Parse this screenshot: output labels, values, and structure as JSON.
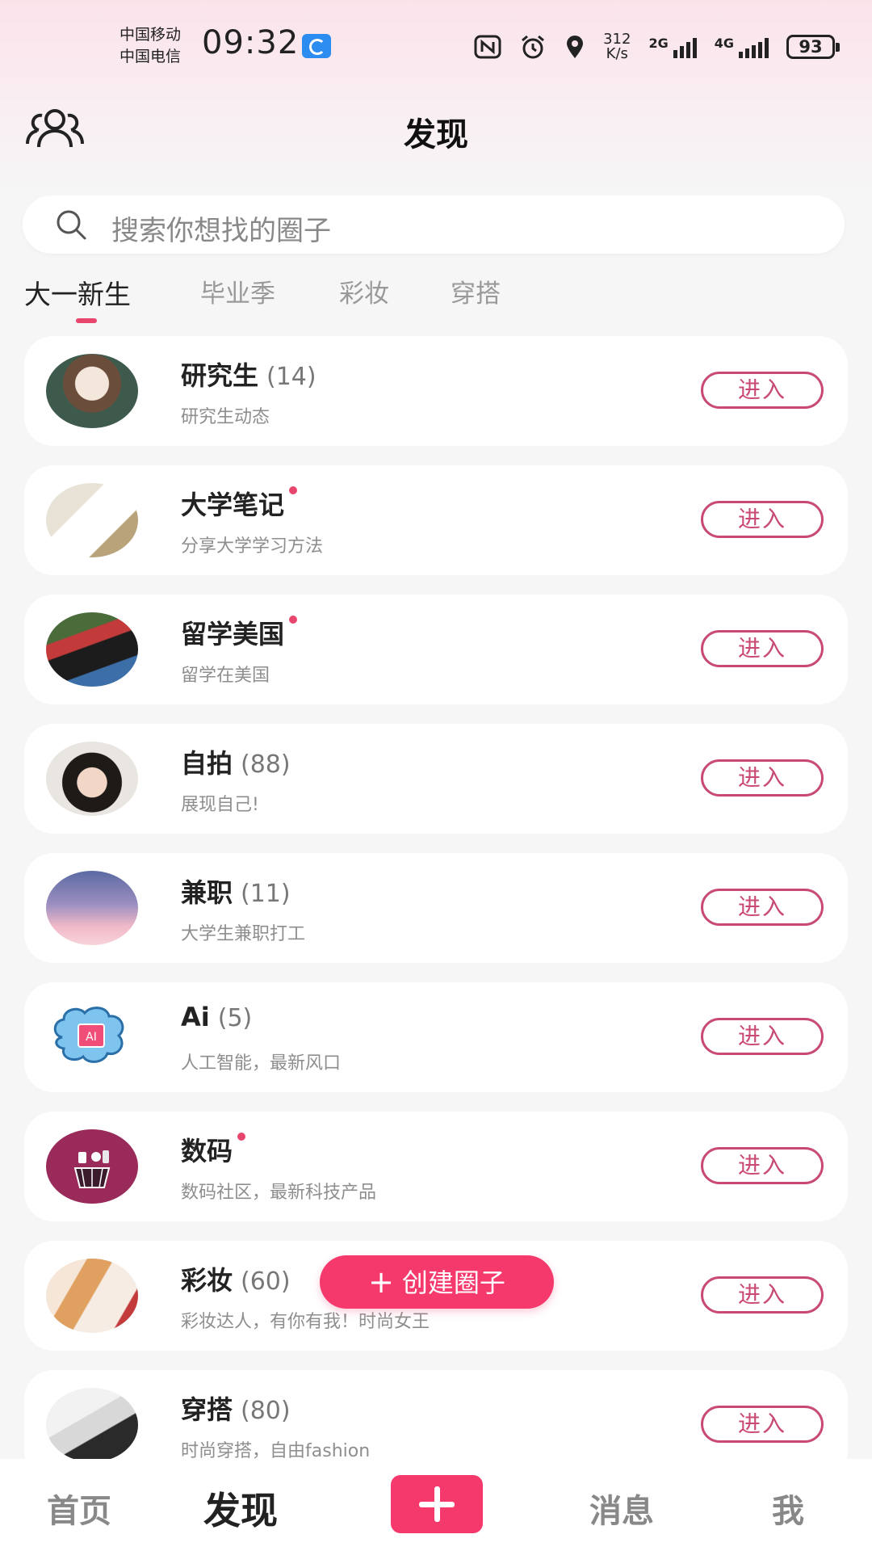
{
  "status_bar": {
    "carrier_1": "中国移动",
    "carrier_2": "中国电信",
    "time": "09:32",
    "net_speed_value": "312",
    "net_speed_unit": "K/s",
    "signal_1_type": "2G",
    "signal_2_type": "4G",
    "battery": "93",
    "icons": [
      "hd-call-icon",
      "nfc-icon",
      "alarm-icon",
      "location-icon",
      "signal-icon",
      "battery-icon"
    ]
  },
  "header": {
    "title": "发现",
    "left_icon": "people-icon"
  },
  "search": {
    "placeholder": "搜索你想找的圈子",
    "icon": "search-icon"
  },
  "tabs": [
    {
      "label": "大一新生",
      "active": true
    },
    {
      "label": "毕业季",
      "active": false
    },
    {
      "label": "彩妆",
      "active": false
    },
    {
      "label": "穿搭",
      "active": false
    }
  ],
  "circles": [
    {
      "name": "研究生",
      "count": "(14)",
      "desc": "研究生动态",
      "has_dot": false,
      "enter": "进入"
    },
    {
      "name": "大学笔记",
      "count": "",
      "desc": "分享大学学习方法",
      "has_dot": true,
      "enter": "进入"
    },
    {
      "name": "留学美国",
      "count": "",
      "desc": "留学在美国",
      "has_dot": true,
      "enter": "进入"
    },
    {
      "name": "自拍",
      "count": "(88)",
      "desc": "展现自己!",
      "has_dot": false,
      "enter": "进入"
    },
    {
      "name": "兼职",
      "count": "(11)",
      "desc": "大学生兼职打工",
      "has_dot": false,
      "enter": "进入"
    },
    {
      "name": "Ai",
      "count": "(5)",
      "desc": "人工智能，最新风口",
      "has_dot": false,
      "enter": "进入"
    },
    {
      "name": "数码",
      "count": "",
      "desc": "数码社区，最新科技产品",
      "has_dot": true,
      "enter": "进入"
    },
    {
      "name": "彩妆",
      "count": "(60)",
      "desc": "彩妆达人，有你有我！时尚女王",
      "has_dot": false,
      "enter": "进入"
    },
    {
      "name": "穿搭",
      "count": "(80)",
      "desc": "时尚穿搭，自由fashion",
      "has_dot": false,
      "enter": "进入"
    }
  ],
  "fab": {
    "label": "创建圈子",
    "plus": "+"
  },
  "bottom_nav": {
    "home": "首页",
    "discover": "发现",
    "messages": "消息",
    "me": "我",
    "active": "发现"
  },
  "colors": {
    "accent": "#f5396c",
    "enter_border": "#c84a72",
    "dot": "#e8466d"
  }
}
